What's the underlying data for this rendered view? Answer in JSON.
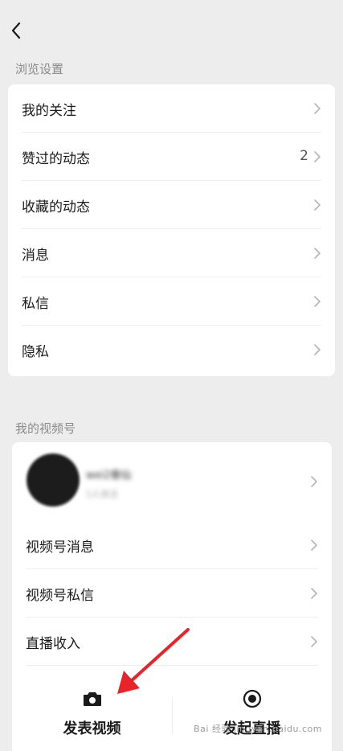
{
  "header": {
    "back_icon": "chevron-left-icon"
  },
  "browse_settings": {
    "title": "浏览设置",
    "items": [
      {
        "label": "我的关注",
        "count": ""
      },
      {
        "label": "赞过的动态",
        "count": "2"
      },
      {
        "label": "收藏的动态",
        "count": ""
      },
      {
        "label": "消息",
        "count": ""
      },
      {
        "label": "私信",
        "count": ""
      },
      {
        "label": "隐私",
        "count": ""
      }
    ]
  },
  "my_channels": {
    "title": "我的视频号",
    "profile": {
      "name": "wei2春仙",
      "subtitle": "1人关注"
    },
    "items": [
      {
        "label": "视频号消息"
      },
      {
        "label": "视频号私信"
      },
      {
        "label": "直播收入"
      }
    ]
  },
  "bottom_actions": [
    {
      "label": "发表视频",
      "icon": "camera-icon"
    },
    {
      "label": "发起直播",
      "icon": "live-record-icon"
    }
  ],
  "annotation": {
    "arrow_color": "#e8242b"
  },
  "watermark": {
    "text": "Bai 经验 jingyan.baidu.com"
  },
  "colors": {
    "background": "#ededed",
    "card": "#ffffff",
    "secondary_text": "#8a8a8a",
    "chevron": "#b5b5b5"
  }
}
